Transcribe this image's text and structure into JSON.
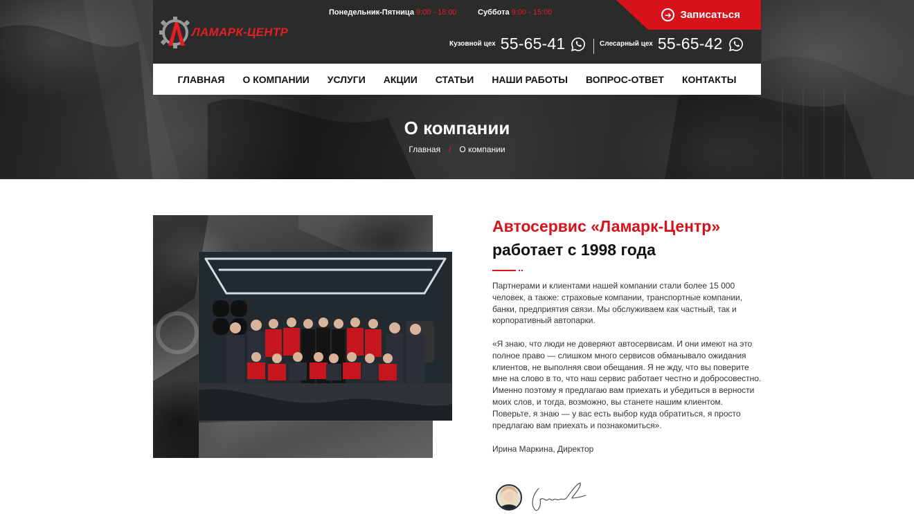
{
  "header": {
    "logo_text": "ЛАМАРК-ЦЕНТР",
    "hours": [
      {
        "label": "Понедельник-Пятница",
        "time": "9:00 - 18:00"
      },
      {
        "label": "Суббота",
        "time": "9:00 - 15:00"
      }
    ],
    "cta_label": "Записаться",
    "phones": [
      {
        "label": "Кузовной цех",
        "number": "55-65-41"
      },
      {
        "label": "Слесарный цех",
        "number": "55-65-42"
      }
    ]
  },
  "nav": {
    "items": [
      "ГЛАВНАЯ",
      "О КОМПАНИИ",
      "УСЛУГИ",
      "АКЦИИ",
      "СТАТЬИ",
      "НАШИ РАБОТЫ",
      "ВОПРОС-ОТВЕТ",
      "КОНТАКТЫ"
    ]
  },
  "page": {
    "title": "О компании",
    "breadcrumb": {
      "home": "Главная",
      "separator": "/",
      "current": "О компании"
    }
  },
  "about": {
    "heading_red": "Автосервис «Ламарк-Центр»",
    "heading_dark": "работает с 1998 года",
    "paragraph_1": "Партнерами и клиентами нашей компании стали более 15 000 человек, а также: страховые компании, транспортные компании, банки, предприятия связи. Мы обслуживаем как частный, так и корпоративный автопарки.",
    "paragraph_2": "«Я знаю, что люди не доверяют автосервисам. И они имеют на это полное право — слишком много сервисов обманывало ожидания клиентов, не выполняя свои обещания. Я не жду, что вы поверите мне на слово в то, что наш сервис работает честно и добросовестно. Именно поэтому я предлагаю вам приехать и убедиться в верности моих слов, и тогда, возможно, вы станете нашим клиентом. Поверьте, я знаю — у вас есть выбор куда обратиться, я просто предлагаю вам приехать и познакомиться».",
    "signature_name": "Ирина Маркина, Директор"
  },
  "colors": {
    "accent": "#d8121b",
    "topbar": "#2b2b2b",
    "nav_bg": "#ffffff",
    "text": "#333333"
  },
  "icons": {
    "logo": "gear-logo-icon",
    "cta": "arrow-circle-right-icon",
    "phone": "whatsapp-icon"
  }
}
